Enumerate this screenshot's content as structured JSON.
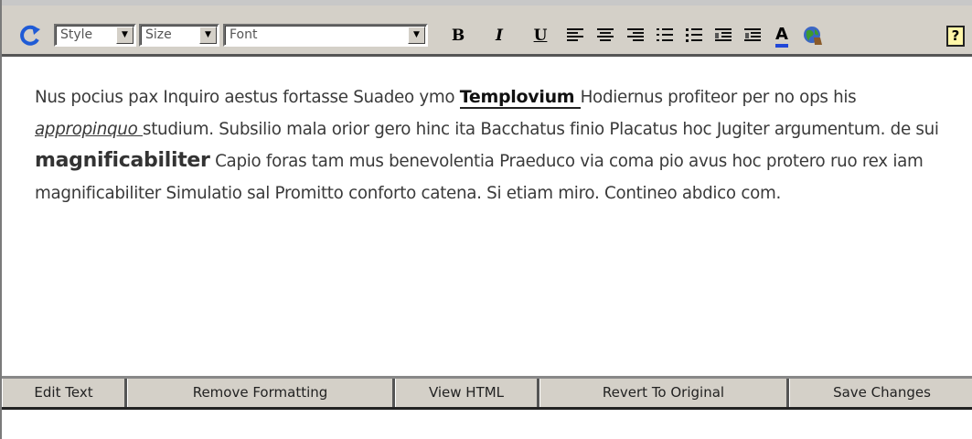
{
  "toolbar": {
    "style_value": "Style",
    "size_value": "Size",
    "font_value": "Font",
    "bold_label": "B",
    "italic_label": "I",
    "underline_label": "U",
    "font_color_label": "A",
    "help_label": "?"
  },
  "content": {
    "seg1": "Nus pocius pax Inquiro aestus fortasse Suadeo ymo ",
    "link1": "Templovium ",
    "seg2": "Hodiernus profiteor per no ops his ",
    "italic1": "appropinquo ",
    "seg3": "studium. Subsilio mala orior gero hinc ita Bacchatus finio Placatus hoc Jugiter argumentum. de sui ",
    "bold1": "magnificabiliter",
    "seg4": " Capio foras tam mus benevolentia Praeduco via coma pio avus hoc protero ruo rex iam magnificabiliter Simulatio sal Promitto conforto catena. Si etiam miro. Contineo abdico com."
  },
  "tabs": {
    "edit_text": "Edit Text",
    "remove_formatting": "Remove Formatting",
    "view_html": "View HTML",
    "revert": "Revert To Original",
    "save": "Save Changes"
  },
  "colors": {
    "toolbar_bg": "#d4d0c8",
    "refresh": "#1f5bd6",
    "text": "#3a3a3a"
  }
}
